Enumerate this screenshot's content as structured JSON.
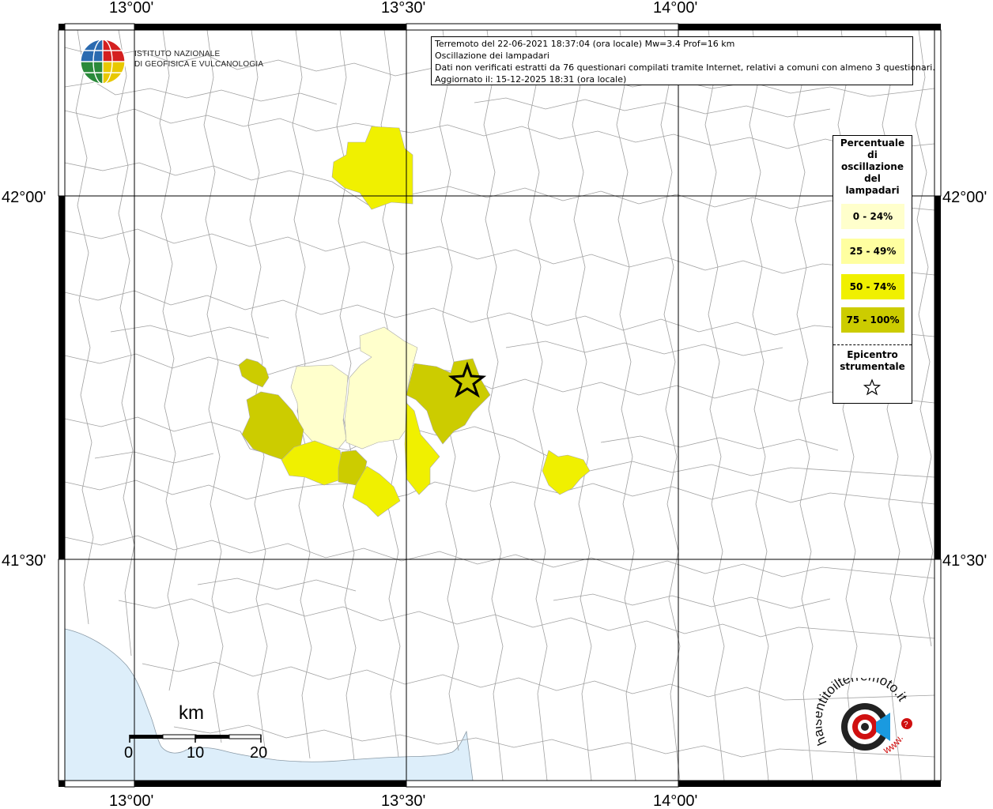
{
  "title_box": {
    "line1": "Terremoto del 22-06-2021 18:37:04 (ora locale) Mw=3.4 Prof=16 km",
    "line2": "Oscillazione dei lampadari",
    "line3": "Dati non verificati estratti da 76 questionari compilati tramite Internet, relativi a comuni con almeno 3 questionari.",
    "line4": "Aggiornato il: 15-12-2025 18:31 (ora locale)"
  },
  "institute": {
    "line1": "ISTITUTO NAZIONALE",
    "line2": "DI GEOFISICA E VULCANOLOGIA"
  },
  "axes": {
    "lon_labels": [
      "13°00'",
      "13°30'",
      "14°00'"
    ],
    "lat_labels": [
      "42°00'",
      "41°30'"
    ]
  },
  "legend": {
    "title_lines": [
      "Percentuale",
      "di",
      "oscillazione",
      "del",
      "lampadari"
    ],
    "classes": [
      {
        "label": "0 - 24%",
        "color": "#ffffcc"
      },
      {
        "label": "25 - 49%",
        "color": "#ffffa0"
      },
      {
        "label": "50 - 74%",
        "color": "#f0f000"
      },
      {
        "label": "75 - 100%",
        "color": "#cccc00"
      }
    ],
    "epicenter_lines": [
      "Epicentro",
      "strumentale"
    ]
  },
  "scale_bar": {
    "unit": "km",
    "ticks": [
      "0",
      "10",
      "20"
    ]
  },
  "colors": {
    "sea": "#ddeefa",
    "border_line": "#999999",
    "grid": "#000000"
  },
  "watermark": {
    "text": "haisentitoilterremoto.it",
    "www": "www.",
    "brand_red": "#d01010"
  }
}
